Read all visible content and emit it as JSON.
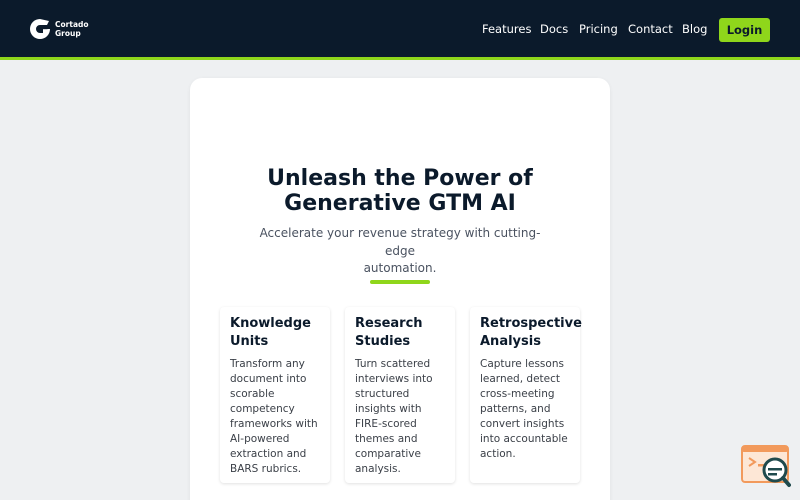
{
  "brand": {
    "line1": "Cortado",
    "line2": "Group"
  },
  "nav": {
    "links": [
      "Features",
      "Docs",
      "Pricing",
      "Contact",
      "Blog"
    ],
    "login_label": "Login"
  },
  "hero": {
    "title_line1": "Unleash the Power of",
    "title_line2": "Generative GTM AI",
    "subtitle_line1": "Accelerate your revenue strategy with cutting-edge",
    "subtitle_line2": "automation."
  },
  "features": [
    {
      "title": [
        "Knowledge",
        "Units"
      ],
      "desc": [
        "Transform any",
        "document into",
        "scorable",
        "competency",
        "frameworks with",
        "AI-powered",
        "extraction and",
        "BARS rubrics."
      ]
    },
    {
      "title": [
        "Research",
        "Studies"
      ],
      "desc": [
        "Turn scattered",
        "interviews into",
        "structured",
        "insights with",
        "FIRE-scored",
        "themes and",
        "comparative",
        "analysis."
      ]
    },
    {
      "title": [
        "Retrospective",
        "Analysis"
      ],
      "desc": [
        "Capture lessons",
        "learned, detect",
        "cross-meeting",
        "patterns, and",
        "convert insights",
        "into accountable",
        "action."
      ]
    }
  ],
  "colors": {
    "nav_bg": "#0b1a2b",
    "accent": "#8fd61b",
    "page_bg": "#eef0f2",
    "text_dark": "#0b1a2b",
    "widget_orange": "#f29a5c",
    "widget_teal": "#1f4a4d"
  },
  "icons": {
    "logo": "cortado-logo-icon",
    "chat": "chat-search-icon"
  }
}
